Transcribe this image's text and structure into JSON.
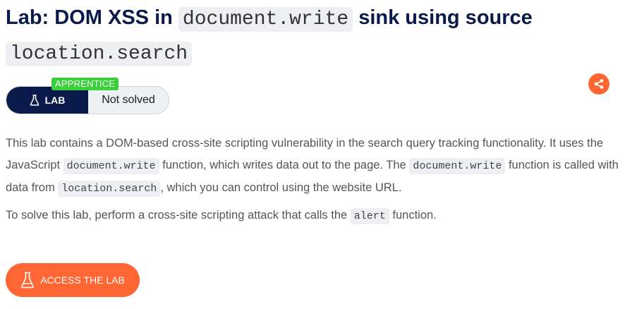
{
  "page": {
    "title_prefix": "Lab: DOM XSS in ",
    "title_code_1": "document.write",
    "title_middle": " sink using source ",
    "title_code_2": "location.search"
  },
  "status": {
    "level": "APPRENTICE",
    "lab_label": "LAB",
    "solved_status": "Not solved"
  },
  "description": {
    "p1_a": "This lab contains a DOM-based cross-site scripting vulnerability in the search query tracking functionality. It uses the JavaScript ",
    "p1_code_1": "document.write",
    "p1_b": " function, which writes data out to the page. The ",
    "p1_code_2": "document.write",
    "p1_c": " function is called with data from ",
    "p1_code_3": "location.search",
    "p1_d": ", which you can control using the website URL.",
    "p2_a": "To solve this lab, perform a cross-site scripting attack that calls the ",
    "p2_code": "alert",
    "p2_b": " function."
  },
  "actions": {
    "access_label": "ACCESS THE LAB"
  },
  "colors": {
    "accent": "#ff6633",
    "navy": "#0a1a4a",
    "level_green": "#3ad03a"
  },
  "icons": {
    "share": "share-icon",
    "flask": "flask-icon"
  }
}
